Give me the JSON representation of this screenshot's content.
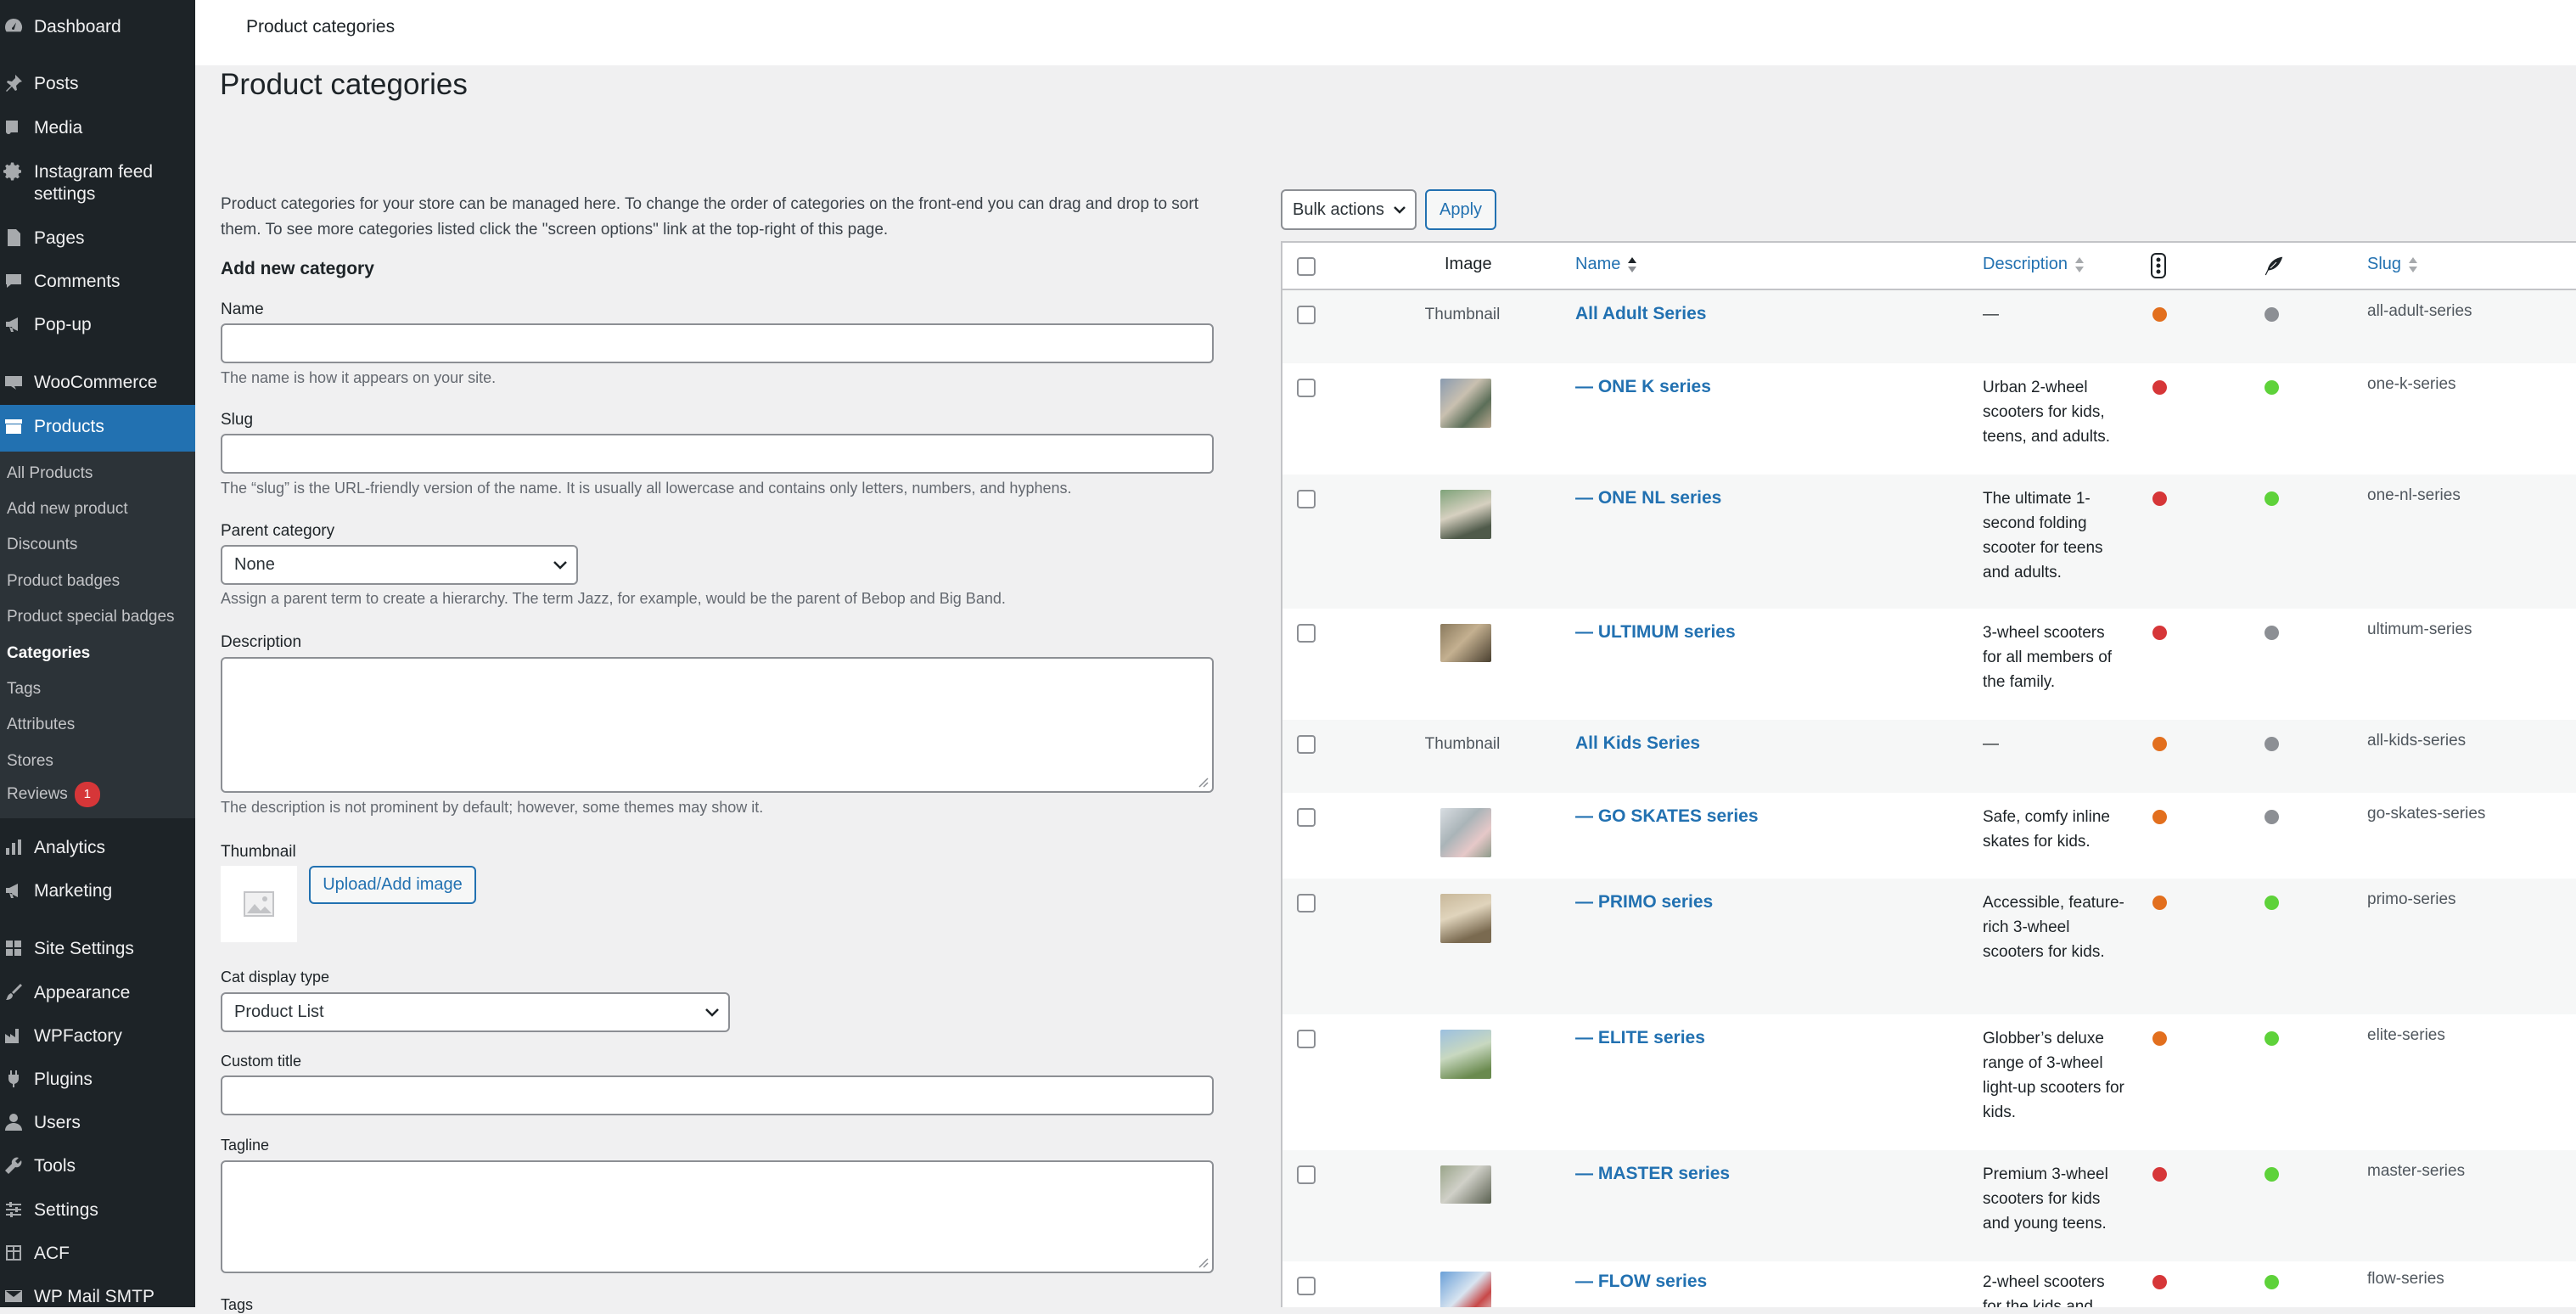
{
  "sidebar": {
    "menu": [
      {
        "label": "Dashboard",
        "icon": "dashboard-icon"
      },
      {
        "label": "Posts",
        "icon": "pin-icon"
      },
      {
        "label": "Media",
        "icon": "media-icon"
      },
      {
        "label": "Instagram feed settings",
        "icon": "gear-icon"
      },
      {
        "label": "Pages",
        "icon": "page-icon"
      },
      {
        "label": "Comments",
        "icon": "comment-icon"
      },
      {
        "label": "Pop-up",
        "icon": "megaphone-icon"
      },
      {
        "label": "WooCommerce",
        "icon": "woo-icon"
      },
      {
        "label": "Products",
        "icon": "archive-icon"
      },
      {
        "label": "Analytics",
        "icon": "bar-chart-icon"
      },
      {
        "label": "Marketing",
        "icon": "megaphone-icon"
      },
      {
        "label": "Site Settings",
        "icon": "grid-icon"
      },
      {
        "label": "Appearance",
        "icon": "paintbrush-icon"
      },
      {
        "label": "WPFactory",
        "icon": "factory-icon"
      },
      {
        "label": "Plugins",
        "icon": "plug-icon"
      },
      {
        "label": "Users",
        "icon": "user-icon"
      },
      {
        "label": "Tools",
        "icon": "wrench-icon"
      },
      {
        "label": "Settings",
        "icon": "settings-icon"
      },
      {
        "label": "ACF",
        "icon": "table-icon"
      },
      {
        "label": "WP Mail SMTP",
        "icon": "mail-icon"
      }
    ],
    "submenu": [
      {
        "label": "All Products"
      },
      {
        "label": "Add new product"
      },
      {
        "label": "Discounts"
      },
      {
        "label": "Product badges"
      },
      {
        "label": "Product special badges"
      },
      {
        "label": "Categories"
      },
      {
        "label": "Tags"
      },
      {
        "label": "Attributes"
      },
      {
        "label": "Stores"
      },
      {
        "label": "Reviews",
        "badge": "1"
      }
    ]
  },
  "header": {
    "title": "Product categories"
  },
  "page": {
    "title": "Product categories",
    "intro": "Product categories for your store can be managed here. To change the order of categories on the front-end you can drag and drop to sort them. To see more categories listed click the \"screen options\" link at the top-right of this page."
  },
  "form": {
    "heading": "Add new category",
    "name_label": "Name",
    "name_help": "The name is how it appears on your site.",
    "slug_label": "Slug",
    "slug_help": "The “slug” is the URL-friendly version of the name. It is usually all lowercase and contains only letters, numbers, and hyphens.",
    "parent_label": "Parent category",
    "parent_value": "None",
    "parent_help": "Assign a parent term to create a hierarchy. The term Jazz, for example, would be the parent of Bebop and Big Band.",
    "description_label": "Description",
    "description_help": "The description is not prominent by default; however, some themes may show it.",
    "thumbnail_label": "Thumbnail",
    "upload_button": "Upload/Add image",
    "cat_display_label": "Cat display type",
    "cat_display_value": "Product List",
    "custom_title_label": "Custom title",
    "tagline_label": "Tagline",
    "tags_label": "Tags"
  },
  "toolbar": {
    "bulk_actions": "Bulk actions",
    "apply": "Apply"
  },
  "table": {
    "headers": {
      "image": "Image",
      "name": "Name",
      "description": "Description",
      "slug": "Slug"
    },
    "colors": {
      "orange": "#e26f1e",
      "red": "#d63638",
      "green": "#5ed23a",
      "gray": "#8c8f94"
    },
    "rows": [
      {
        "image": "Thumbnail",
        "name": "All Adult Series",
        "description": "—",
        "slug": "all-adult-series",
        "dot1": "orange",
        "dot2": "gray"
      },
      {
        "image": "photo",
        "name": "— ONE K series",
        "description": "Urban 2-wheel scooters for kids, teens, and adults.",
        "slug": "one-k-series",
        "dot1": "red",
        "dot2": "green"
      },
      {
        "image": "photo",
        "name": "— ONE NL series",
        "description": "The ultimate 1-second folding scooter for teens and adults.",
        "slug": "one-nl-series",
        "dot1": "red",
        "dot2": "green"
      },
      {
        "image": "photo",
        "name": "— ULTIMUM series",
        "description": "3-wheel scooters for all members of the family.",
        "slug": "ultimum-series",
        "dot1": "red",
        "dot2": "gray"
      },
      {
        "image": "Thumbnail",
        "name": "All Kids Series",
        "description": "—",
        "slug": "all-kids-series",
        "dot1": "orange",
        "dot2": "gray"
      },
      {
        "image": "photo",
        "name": "— GO SKATES series",
        "description": "Safe, comfy inline skates for kids.",
        "slug": "go-skates-series",
        "dot1": "orange",
        "dot2": "gray"
      },
      {
        "image": "photo",
        "name": "— PRIMO series",
        "description": "Accessible, feature-rich 3-wheel scooters for kids.",
        "slug": "primo-series",
        "dot1": "orange",
        "dot2": "green"
      },
      {
        "image": "photo",
        "name": "— ELITE series",
        "description": "Globber’s deluxe range of 3-wheel light-up scooters for kids.",
        "slug": "elite-series",
        "dot1": "orange",
        "dot2": "green"
      },
      {
        "image": "photo",
        "name": "— MASTER series",
        "description": "Premium 3-wheel scooters for kids and young teens.",
        "slug": "master-series",
        "dot1": "red",
        "dot2": "green"
      },
      {
        "image": "photo",
        "name": "— FLOW series",
        "description": "2-wheel scooters for the kids and",
        "slug": "flow-series",
        "dot1": "red",
        "dot2": "green"
      }
    ]
  }
}
